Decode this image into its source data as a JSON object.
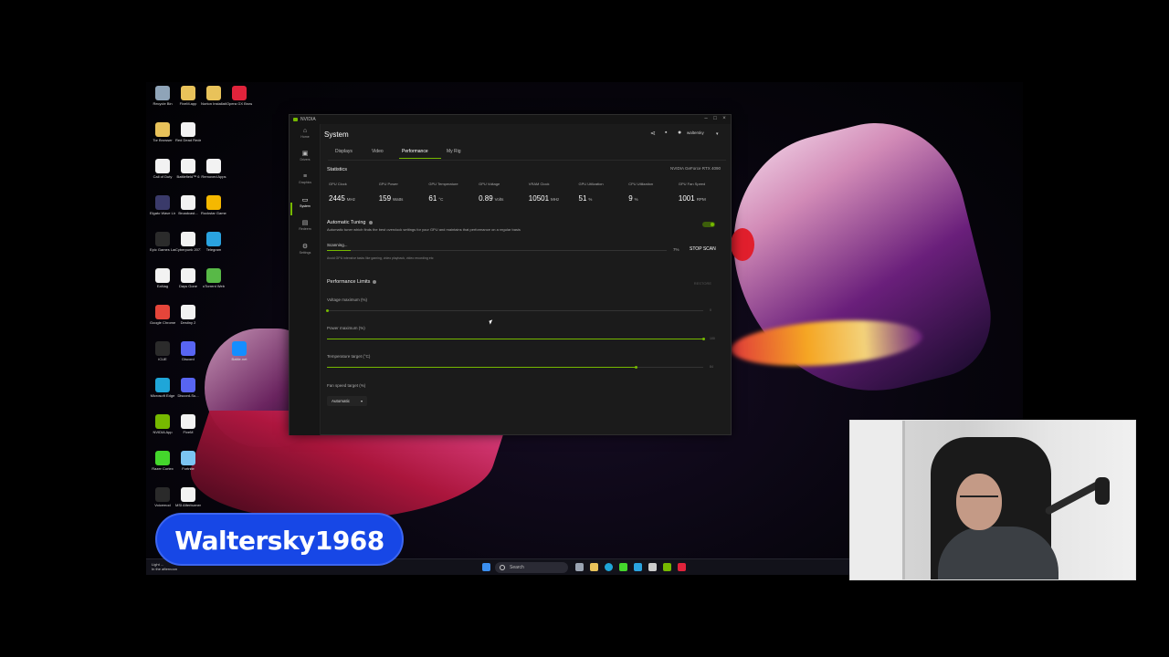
{
  "desktop": {
    "icons": [
      {
        "label": "Recycle Bin",
        "color": "#8fa4b8"
      },
      {
        "label": "FiveM.app",
        "color": "#e8c25a"
      },
      {
        "label": "Norton Installati...",
        "color": "#e8c25a"
      },
      {
        "label": "Opera GX Browser",
        "color": "#e0233b"
      },
      {
        "label": "Tor Browser",
        "color": "#e8c25a"
      },
      {
        "label": "Red Dead Redempti...",
        "color": "#f2f2f2"
      },
      {
        "label": "Call of Duty",
        "color": "#f2f2f2"
      },
      {
        "label": "Battlefield™ 6",
        "color": "#f2f2f2"
      },
      {
        "label": "Removed Apps",
        "color": "#f2f2f2"
      },
      {
        "label": "Elgato Wave Link",
        "color": "#3a3a6a"
      },
      {
        "label": "Broadcast...",
        "color": "#f2f2f2"
      },
      {
        "label": "Rockstar Games...",
        "color": "#f5b800"
      },
      {
        "label": "Epic Games Launcher",
        "color": "#2b2b2b"
      },
      {
        "label": "Cyberpunk 2077",
        "color": "#f2f2f2"
      },
      {
        "label": "Telegram",
        "color": "#2aa3e0"
      },
      {
        "label": "EaNag",
        "color": "#f2f2f2"
      },
      {
        "label": "Days Gone",
        "color": "#f2f2f2"
      },
      {
        "label": "uTorrent Web",
        "color": "#58b947"
      },
      {
        "label": "Google Chrome",
        "color": "#e5453a"
      },
      {
        "label": "Destiny 2",
        "color": "#f2f2f2"
      },
      {
        "label": "iCUE",
        "color": "#2b2b2b"
      },
      {
        "label": "Discord",
        "color": "#5865f2"
      },
      {
        "label": "Battle.net",
        "color": "#148eff"
      },
      {
        "label": "Microsoft Edge",
        "color": "#1fa6d8"
      },
      {
        "label": "Discord-Su...",
        "color": "#5865f2"
      },
      {
        "label": "NVIDIA App",
        "color": "#76b900"
      },
      {
        "label": "FiveM",
        "color": "#f2f2f2"
      },
      {
        "label": "Razer Cortex",
        "color": "#44d62c"
      },
      {
        "label": "Fortnite",
        "color": "#7bc4f2"
      },
      {
        "label": "Voicemod",
        "color": "#2a2a2a"
      },
      {
        "label": "MSI Afterburner",
        "color": "#f2f2f2"
      }
    ]
  },
  "taskbar": {
    "weather_line1": "Light ...",
    "weather_line2": "In the afternoon",
    "search_placeholder": "Search"
  },
  "nvidia_app": {
    "window_title": "NVIDIA",
    "page_title": "System",
    "user_name": "waltersky",
    "rail": [
      {
        "label": "Home",
        "icon": "home-icon",
        "glyph": "⌂"
      },
      {
        "label": "Drivers",
        "icon": "drivers-icon",
        "glyph": "▣"
      },
      {
        "label": "Graphics",
        "icon": "graphics-icon",
        "glyph": "≡"
      },
      {
        "label": "System",
        "icon": "system-icon",
        "glyph": "▭"
      },
      {
        "label": "Redeem",
        "icon": "redeem-icon",
        "glyph": "▤"
      },
      {
        "label": "Settings",
        "icon": "gear-icon",
        "glyph": "⚙"
      }
    ],
    "tabs": [
      "Displays",
      "Video",
      "Performance",
      "My Rig"
    ],
    "active_tab": "Performance",
    "statistics": {
      "title": "Statistics",
      "gpu_name": "NVIDIA GeForce RTX 4090",
      "items": [
        {
          "label": "GPU Clock",
          "value": "2445",
          "unit": "MHz"
        },
        {
          "label": "GPU Power",
          "value": "159",
          "unit": "Watts"
        },
        {
          "label": "GPU Temperature",
          "value": "61",
          "unit": "°C"
        },
        {
          "label": "GPU Voltage",
          "value": "0.89",
          "unit": "Volts"
        },
        {
          "label": "VRAM Clock",
          "value": "10501",
          "unit": "MHz"
        },
        {
          "label": "GPU Utilization",
          "value": "51",
          "unit": "%"
        },
        {
          "label": "CPU Utilization",
          "value": "9",
          "unit": "%"
        },
        {
          "label": "GPU Fan Speed",
          "value": "1001",
          "unit": "RPM"
        }
      ]
    },
    "auto_tuning": {
      "title": "Automatic Tuning",
      "description": "Automatic tuner which finds the best overclock settings for your GPU and maintains that performance on a regular basis",
      "enabled": true,
      "status": "Scanning...",
      "progress_percent": 7,
      "progress_label": "7%",
      "stop_label": "STOP SCAN",
      "note": "Avoid GPU intensive tasks like gaming, video playback, video recording etc"
    },
    "performance_limits": {
      "title": "Performance Limits",
      "restore_label": "RESTORE",
      "sliders": [
        {
          "label": "Voltage maximum (%)",
          "value_label": "0",
          "fill_fraction": 0.0
        },
        {
          "label": "Power maximum (%)",
          "value_label": "100",
          "fill_fraction": 1.0
        },
        {
          "label": "Temperature target (°C)",
          "value_label": "84",
          "fill_fraction": 0.82
        }
      ],
      "fan_label": "Fan speed target (%)",
      "fan_mode": "Automatic"
    }
  },
  "overlay": {
    "streamer_name": "Waltersky1968",
    "banner_color": "#1747e6",
    "accent": "#76b900"
  }
}
